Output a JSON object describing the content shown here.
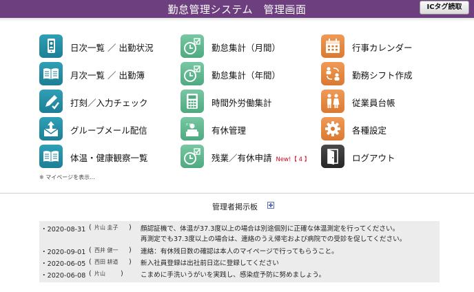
{
  "header": {
    "title": "勤怠管理システム　管理画面",
    "ic_button": "ICタグ読取",
    "bg_color": "#6e3f7f"
  },
  "menu": {
    "col1": [
      {
        "label": "日次一覧 ／ 出勤状況",
        "icon": "smartphone-user-icon"
      },
      {
        "label": "月次一覧 ／ 出勤簿",
        "icon": "open-book-icon"
      },
      {
        "label": "打刻／入力チェック",
        "icon": "pencil-check-icon"
      },
      {
        "label": "グループメール配信",
        "icon": "mail-upload-icon"
      },
      {
        "label": "体温・健康観察一覧",
        "icon": "open-book-icon"
      }
    ],
    "col2": [
      {
        "label": "勤怠集計（月間）",
        "icon": "clock-check-icon"
      },
      {
        "label": "勤怠集計（年間）",
        "icon": "clock-check-icon"
      },
      {
        "label": "時間外労働集計",
        "icon": "calculator-icon"
      },
      {
        "label": "有休管理",
        "icon": "resting-person-icon"
      },
      {
        "label": "残業／有休申請",
        "icon": "clock-check-icon",
        "badge": "New!【 4 】"
      }
    ],
    "col3": [
      {
        "label": "行事カレンダー",
        "icon": "calendar-icon"
      },
      {
        "label": "勤務シフト作成",
        "icon": "shift-swap-icon"
      },
      {
        "label": "従業員台帳",
        "icon": "staff-people-icon"
      },
      {
        "label": "各種設定",
        "icon": "gear-icon"
      },
      {
        "label": "ログアウト",
        "icon": "logout-door-icon"
      }
    ]
  },
  "note": "※ マイページを表示...",
  "board": {
    "title": "管理者掲示板",
    "posts": [
      {
        "date": "・2020-08-31",
        "name": "片山 圭子",
        "lines": [
          "顔認証機で、体温が37.3度以上の場合は別途個別に正確な体温測定を行ってください。",
          "再測定でも37.3度以上の場合は、連絡のうえ帰宅および病院での受診を促してください。"
        ]
      },
      {
        "date": "・2020-09-01",
        "name": "西井 健一",
        "lines": [
          "連絡：有休残日数の確認は本人のマイページで行ってもらうこと。"
        ]
      },
      {
        "date": "・2020-06-05",
        "name": "西田 耕道",
        "lines": [
          "新入社員登録は出社前日迄に登録してください"
        ]
      },
      {
        "date": "・2020-06-08",
        "name": "片山",
        "lines": [
          "こまめに手洗いうがいを実践し、感染症予防に努めましょう。"
        ]
      }
    ]
  }
}
